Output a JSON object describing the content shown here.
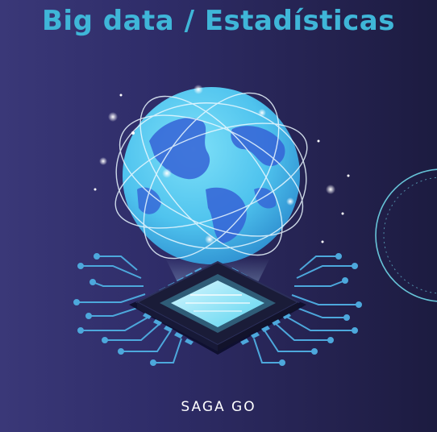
{
  "title": "Big data / Estadísticas",
  "brand": "SAGA GO",
  "icons": [
    "globe-icon",
    "microchip-icon",
    "circuit-lines-icon",
    "sparkle-stars-icon",
    "ring-decoration-icon"
  ],
  "colors": {
    "title": "#3fb6d8",
    "globe_ocean": "#4fc3ee",
    "globe_land": "#3563d6",
    "chip": "#1a1c38",
    "chip_core": "#5ad4ef",
    "circuit": "#4da8dc",
    "brand_text": "#ffffff"
  }
}
